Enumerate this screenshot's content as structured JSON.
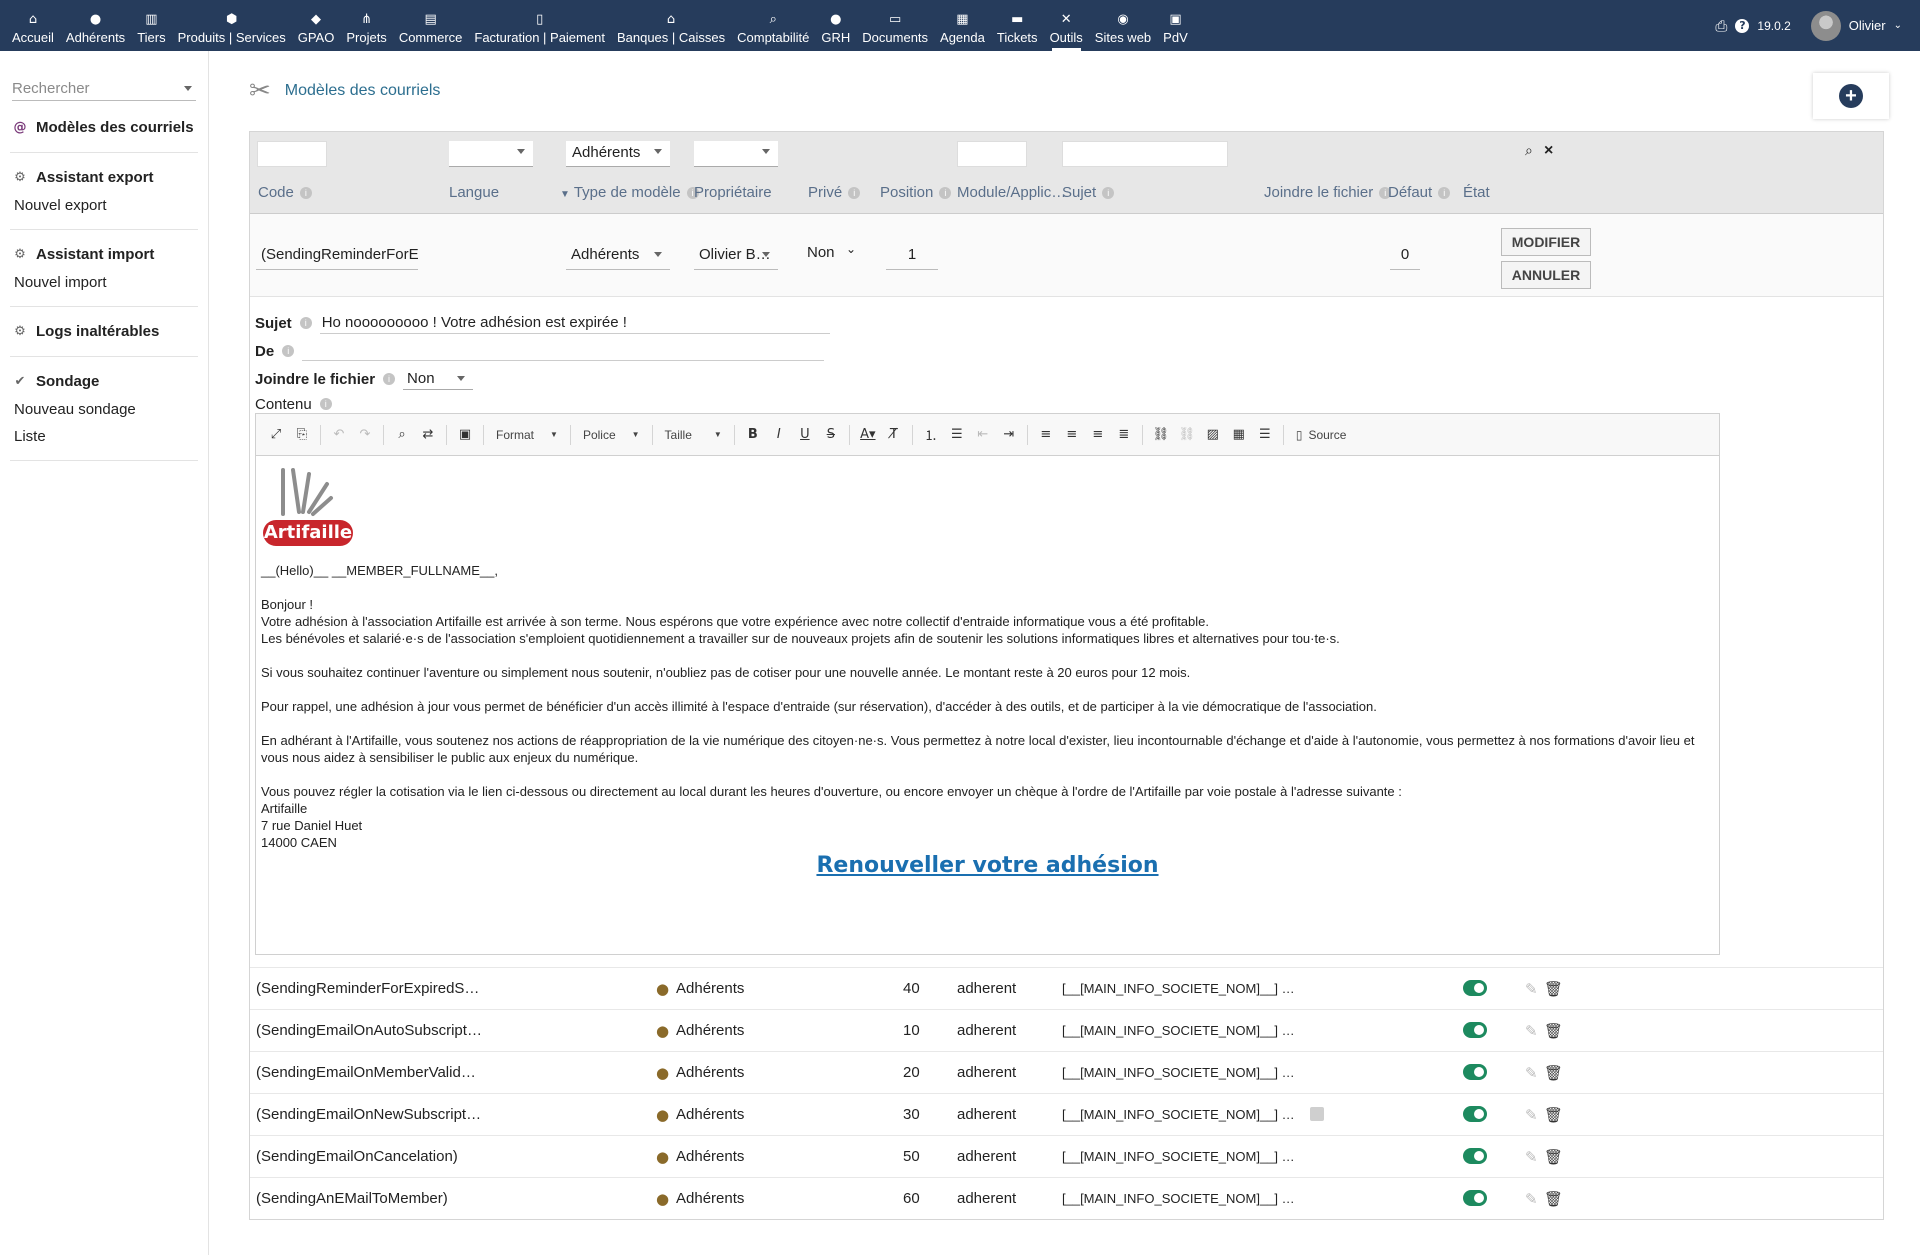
{
  "topnav": {
    "items": [
      {
        "label": "Accueil",
        "icon": "home-icon",
        "glyph": "⌂"
      },
      {
        "label": "Adhérents",
        "icon": "user-icon",
        "glyph": "●"
      },
      {
        "label": "Tiers",
        "icon": "building-icon",
        "glyph": "▥"
      },
      {
        "label": "Produits | Services",
        "icon": "cube-icon",
        "glyph": "⬢"
      },
      {
        "label": "GPAO",
        "icon": "cubes-icon",
        "glyph": "◆"
      },
      {
        "label": "Projets",
        "icon": "sitemap-icon",
        "glyph": "⋔"
      },
      {
        "label": "Commerce",
        "icon": "briefcase-icon",
        "glyph": "▤"
      },
      {
        "label": "Facturation | Paiement",
        "icon": "file-invoice-icon",
        "glyph": "▯"
      },
      {
        "label": "Banques | Caisses",
        "icon": "bank-icon",
        "glyph": "⌂"
      },
      {
        "label": "Comptabilité",
        "icon": "magnifier-icon",
        "glyph": "⌕"
      },
      {
        "label": "GRH",
        "icon": "user-tie-icon",
        "glyph": "●"
      },
      {
        "label": "Documents",
        "icon": "folder-icon",
        "glyph": "▭"
      },
      {
        "label": "Agenda",
        "icon": "calendar-icon",
        "glyph": "▦"
      },
      {
        "label": "Tickets",
        "icon": "ticket-icon",
        "glyph": "▬"
      },
      {
        "label": "Outils",
        "icon": "tools-icon",
        "glyph": "✕"
      },
      {
        "label": "Sites web",
        "icon": "globe-icon",
        "glyph": "◉"
      },
      {
        "label": "PdV",
        "icon": "cash-register-icon",
        "glyph": "▣"
      }
    ],
    "version": "19.0.2",
    "user": "Olivier"
  },
  "sidebar": {
    "search_placeholder": "Rechercher",
    "sections": [
      {
        "head": "Modèles des courriels",
        "icon": "at-icon",
        "items": []
      },
      {
        "head": "Assistant export",
        "icon": "cogs-icon",
        "items": [
          "Nouvel export"
        ]
      },
      {
        "head": "Assistant import",
        "icon": "cogs-icon",
        "items": [
          "Nouvel import"
        ]
      },
      {
        "head": "Logs inaltérables",
        "icon": "cogs-icon",
        "items": []
      },
      {
        "head": "Sondage",
        "icon": "check-double-icon",
        "items": [
          "Nouveau sondage",
          "Liste"
        ]
      }
    ]
  },
  "page": {
    "title": "Modèles des courriels"
  },
  "filters": {
    "type": "Adhérents"
  },
  "columns": {
    "code": "Code",
    "lang": "Langue",
    "type": "Type de modèle",
    "owner": "Propriétaire",
    "private": "Privé",
    "position": "Position",
    "module": "Module/Applic…",
    "subject": "Sujet",
    "attach": "Joindre le fichier",
    "default": "Défaut",
    "state": "État"
  },
  "edit": {
    "code": "(SendingReminderForExpired",
    "type": "Adhérents",
    "owner": "Olivier B…",
    "private": "Non",
    "position": "1",
    "default": "0",
    "modify": "MODIFIER",
    "cancel": "ANNULER"
  },
  "form": {
    "subject_label": "Sujet",
    "subject_value": "Ho nooooooooo ! Votre adhésion est expirée !",
    "from_label": "De",
    "attach_label": "Joindre le fichier",
    "attach_value": "Non",
    "content_label": "Contenu"
  },
  "toolbar": {
    "format": "Format",
    "font": "Police",
    "size": "Taille",
    "source": "Source"
  },
  "content": {
    "logo_text": "Artifaille",
    "lines": [
      "__(Hello)__ __MEMBER_FULLNAME__,",
      "",
      "Bonjour !",
      "Votre adhésion à l'association Artifaille est arrivée à son terme. Nous espérons que votre expérience avec notre collectif d'entraide informatique vous a été profitable.",
      "Les bénévoles et salarié·e·s de l'association s'emploient quotidiennement a travailler sur de nouveaux projets afin de soutenir les solutions informatiques libres et alternatives pour tou·te·s.",
      "",
      "Si vous souhaitez continuer l'aventure ou simplement nous soutenir, n'oubliez pas de cotiser pour une nouvelle année. Le montant reste à 20 euros pour 12 mois.",
      "",
      "Pour rappel, une adhésion à jour vous permet de bénéficier d'un accès illimité à l'espace d'entraide (sur réservation), d'accéder à des outils, et de participer à la vie démocratique de l'association.",
      "",
      "En adhérant à l'Artifaille, vous soutenez nos actions de réappropriation de la vie numérique des citoyen·ne·s. Vous permettez à notre local d'exister, lieu incontournable d'échange et d'aide à l'autonomie, vous permettez à nos formations d'avoir lieu et vous nous aidez à sensibiliser le public aux enjeux du numérique.",
      "",
      "Vous pouvez régler la cotisation via le lien ci-dessous ou directement au local durant les heures d'ouverture, ou encore envoyer un chèque à l'ordre de l'Artifaille par voie postale à l'adresse suivante :",
      "Artifaille",
      "7 rue Daniel Huet",
      "14000 CAEN"
    ],
    "link": "Renouveller votre adhésion"
  },
  "rows": [
    {
      "code": "(SendingReminderForExpiredS…",
      "type": "Adhérents",
      "position": "40",
      "module": "adherent",
      "subject": "[__[MAIN_INFO_SOCIETE_NOM]__] …",
      "attach": false
    },
    {
      "code": "(SendingEmailOnAutoSubscript…",
      "type": "Adhérents",
      "position": "10",
      "module": "adherent",
      "subject": "[__[MAIN_INFO_SOCIETE_NOM]__] …",
      "attach": false
    },
    {
      "code": "(SendingEmailOnMemberValid…",
      "type": "Adhérents",
      "position": "20",
      "module": "adherent",
      "subject": "[__[MAIN_INFO_SOCIETE_NOM]__] …",
      "attach": false
    },
    {
      "code": "(SendingEmailOnNewSubscript…",
      "type": "Adhérents",
      "position": "30",
      "module": "adherent",
      "subject": "[__[MAIN_INFO_SOCIETE_NOM]__] …",
      "attach": true
    },
    {
      "code": "(SendingEmailOnCancelation)",
      "type": "Adhérents",
      "position": "50",
      "module": "adherent",
      "subject": "[__[MAIN_INFO_SOCIETE_NOM]__] …",
      "attach": false
    },
    {
      "code": "(SendingAnEMailToMember)",
      "type": "Adhérents",
      "position": "60",
      "module": "adherent",
      "subject": "[__[MAIN_INFO_SOCIETE_NOM]__] …",
      "attach": false
    }
  ],
  "colors": {
    "topbar": "#263c5c",
    "toggle_on": "#1d8a5f",
    "link": "#1a6fb0",
    "logo_red": "#c8262c"
  }
}
